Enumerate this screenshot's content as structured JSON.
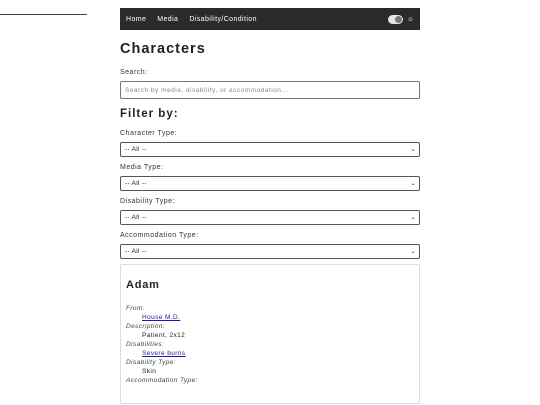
{
  "nav": {
    "links": [
      "Home",
      "Media",
      "Disability/Condition"
    ],
    "theme_icon": "sun-icon"
  },
  "page": {
    "title": "Characters"
  },
  "search": {
    "label": "Search:",
    "placeholder": "Search by media, disability, or accommodation...",
    "value": ""
  },
  "filters": {
    "title": "Filter by:",
    "items": [
      {
        "label": "Character Type:",
        "selected": "-- All --"
      },
      {
        "label": "Media Type:",
        "selected": "-- All --"
      },
      {
        "label": "Disability Type:",
        "selected": "-- All --"
      },
      {
        "label": "Accommodation Type:",
        "selected": "-- All --"
      }
    ]
  },
  "card": {
    "name": "Adam",
    "from_label": "From:",
    "from_value": "House M.D.",
    "description_label": "Description:",
    "description_value": "Patient, 2x12",
    "disabilities_label": "Disabilities:",
    "disabilities_value": "Severe burns",
    "disability_type_label": "Disability Type:",
    "disability_type_value": "Skin",
    "accommodation_type_label": "Accommodation Type:"
  },
  "colors": {
    "navbar": "#2b2b2b",
    "link": "#1a1aa6"
  }
}
